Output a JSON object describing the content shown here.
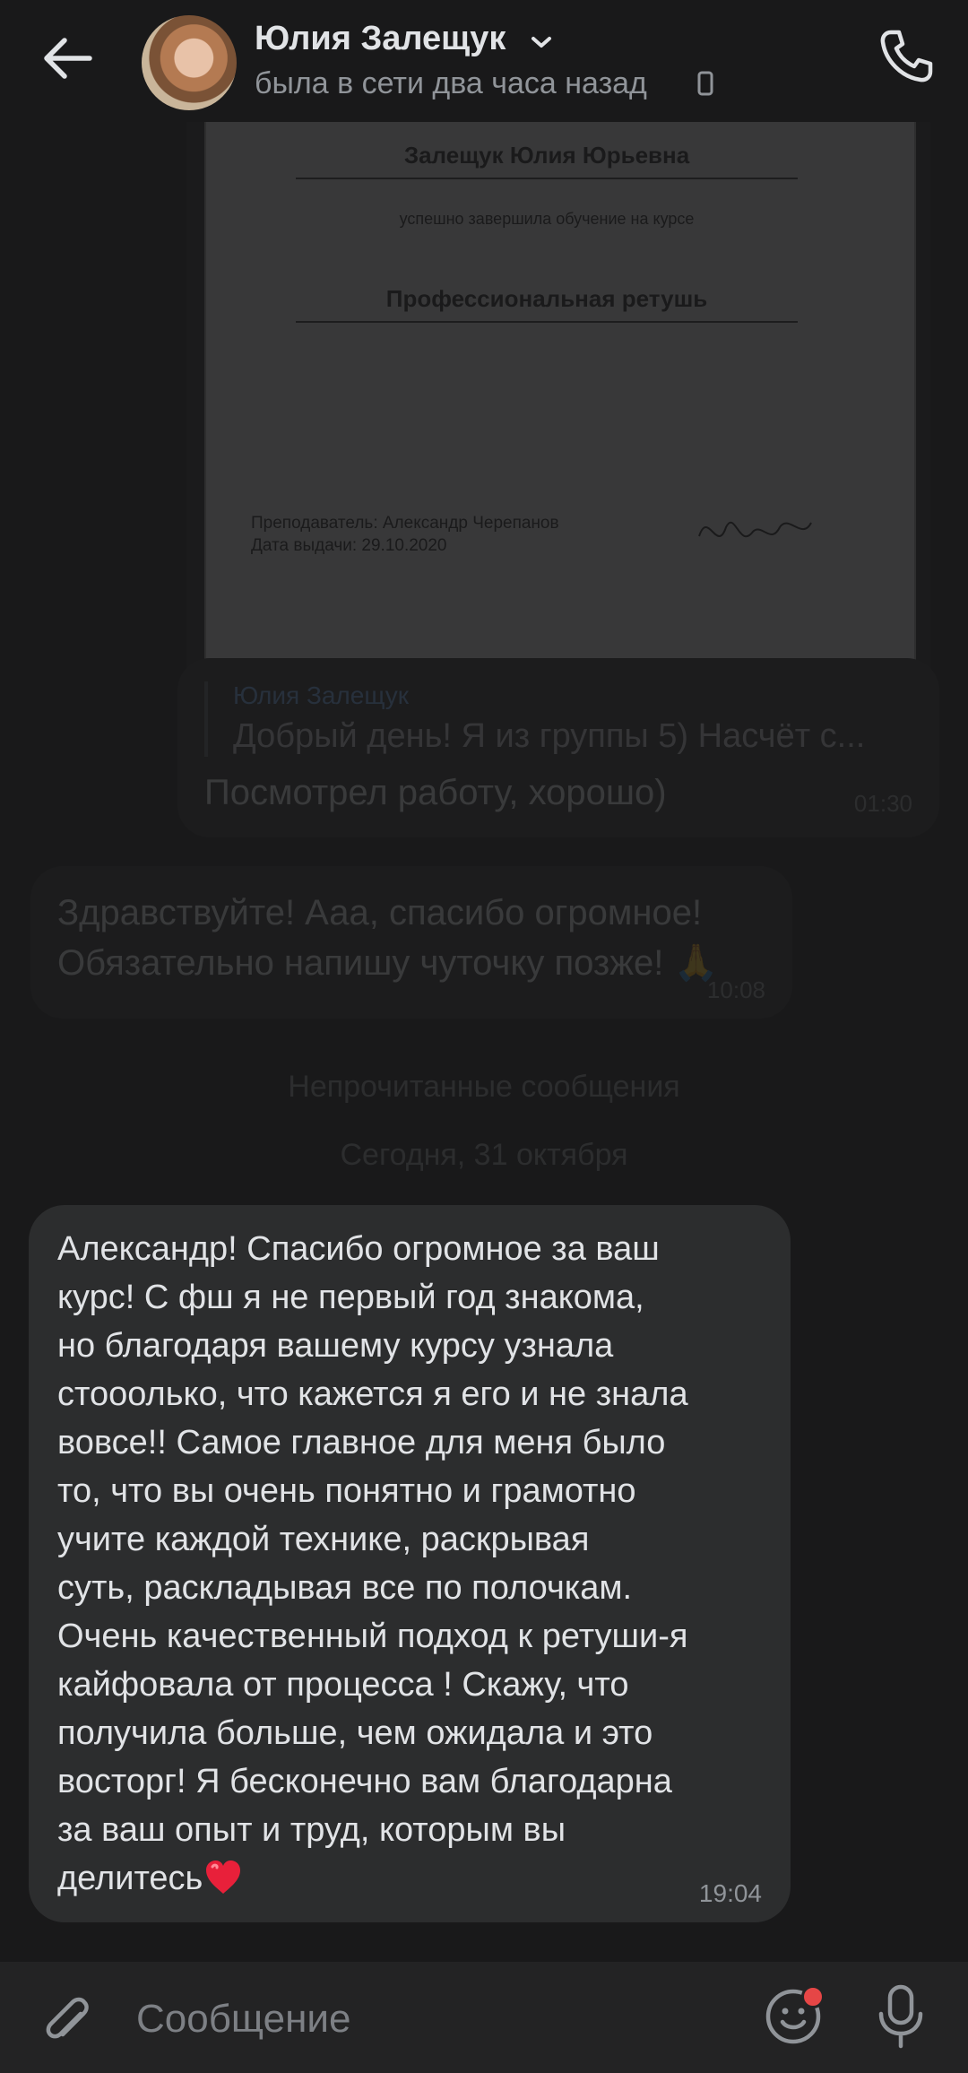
{
  "header": {
    "contact_name": "Юлия Залещук",
    "status": "была в сети два часа назад"
  },
  "certificate": {
    "recipient": "Залещук Юлия Юрьевна",
    "completion": "успешно завершила обучение на курсе",
    "course": "Профессиональная ретушь",
    "teacher": "Преподаватель: Александр Черепанов",
    "issue_date": "Дата выдачи: 29.10.2020",
    "time": "01:30"
  },
  "reply_message": {
    "quoted_author": "Юлия Залещук",
    "quoted_text": "Добрый день! Я из группы 5) Насчёт с...",
    "text": "Посмотрел работу, хорошо)",
    "time": "01:30"
  },
  "thanks_message": {
    "text": "Здравствуйте! Ааа, спасибо огромное! Обязательно напишу чуточку позже! 🙏",
    "time": "10:08"
  },
  "separators": {
    "unread": "Непрочитанные сообщения",
    "date": "Сегодня, 31 октября"
  },
  "main_message": {
    "text": "Александр! Спасибо огромное за ваш\nкурс! С фш я не первый год знакома,\nно благодаря вашему курсу узнала\nстооолько, что кажется я его и не знала\nвовсе!! Самое главное для меня было\nто, что вы очень понятно и грамотно\nучите каждой технике, раскрывая\nсуть, раскладывая все по полочкам.\nОчень качественный подход к ретуши-я\nкайфовала от процесса ! Скажу, что\nполучила больше, чем ожидала и это\nвосторг! Я бесконечно вам благодарна\nза ваш опыт и труд, которым вы\nделитесь",
    "time": "19:04"
  },
  "composer": {
    "placeholder": "Сообщение"
  },
  "icons": {
    "back": "arrow-left-icon",
    "call": "phone-icon",
    "attach": "paperclip-icon",
    "emoji": "smiley-icon",
    "mic": "microphone-icon"
  },
  "colors": {
    "background": "#19191a",
    "bubble": "#2c2d2e",
    "notification_dot": "#e64646"
  }
}
